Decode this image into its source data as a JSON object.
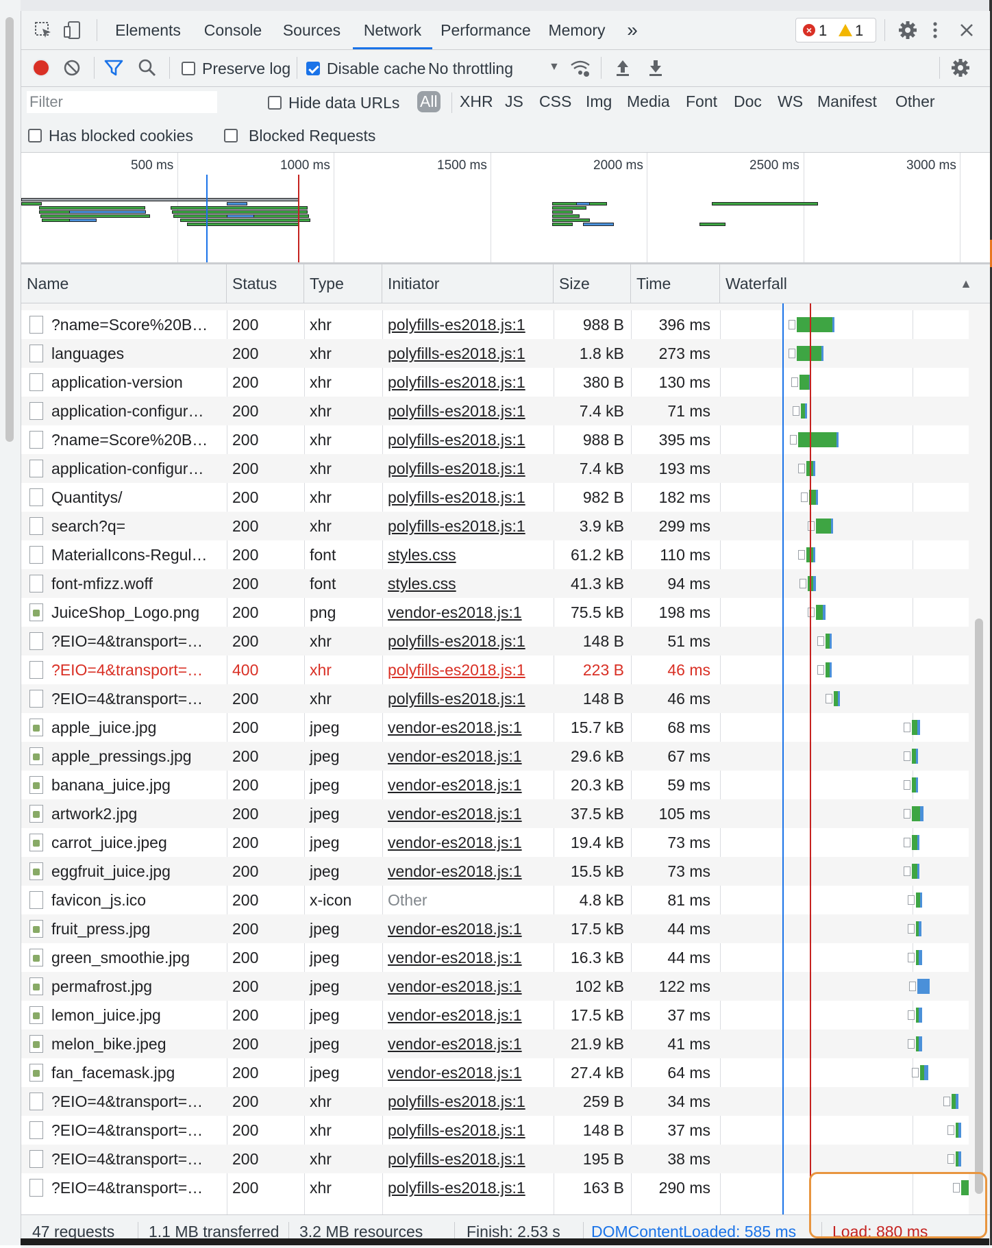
{
  "tabs": {
    "elements": "Elements",
    "console": "Console",
    "sources": "Sources",
    "network": "Network",
    "performance": "Performance",
    "memory": "Memory",
    "more": "»",
    "errors": "1",
    "warnings": "1"
  },
  "toolbar": {
    "preserve_log": "Preserve log",
    "disable_cache": "Disable cache",
    "throttling": "No throttling"
  },
  "filter": {
    "placeholder": "Filter",
    "hide_data_urls": "Hide data URLs",
    "types": [
      "All",
      "XHR",
      "JS",
      "CSS",
      "Img",
      "Media",
      "Font",
      "Doc",
      "WS",
      "Manifest",
      "Other"
    ],
    "has_blocked_cookies": "Has blocked cookies",
    "blocked_requests": "Blocked Requests"
  },
  "overview": {
    "ticks": [
      "500 ms",
      "1000 ms",
      "1500 ms",
      "2000 ms",
      "2500 ms",
      "3000 ms"
    ]
  },
  "columns": {
    "name": "Name",
    "status": "Status",
    "type": "Type",
    "initiator": "Initiator",
    "size": "Size",
    "time": "Time",
    "waterfall": "Waterfall",
    "sort_icon": "▲"
  },
  "requests": [
    {
      "name": "?name=Score%20B…",
      "status": "200",
      "type": "xhr",
      "initiator": "polyfills-es2018.js:1",
      "size": "988 B",
      "time": "396 ms",
      "icon": "file"
    },
    {
      "name": "languages",
      "status": "200",
      "type": "xhr",
      "initiator": "polyfills-es2018.js:1",
      "size": "1.8 kB",
      "time": "273 ms",
      "icon": "file"
    },
    {
      "name": "application-version",
      "status": "200",
      "type": "xhr",
      "initiator": "polyfills-es2018.js:1",
      "size": "380 B",
      "time": "130 ms",
      "icon": "file"
    },
    {
      "name": "application-configur…",
      "status": "200",
      "type": "xhr",
      "initiator": "polyfills-es2018.js:1",
      "size": "7.4 kB",
      "time": "71 ms",
      "icon": "file"
    },
    {
      "name": "?name=Score%20B…",
      "status": "200",
      "type": "xhr",
      "initiator": "polyfills-es2018.js:1",
      "size": "988 B",
      "time": "395 ms",
      "icon": "file"
    },
    {
      "name": "application-configur…",
      "status": "200",
      "type": "xhr",
      "initiator": "polyfills-es2018.js:1",
      "size": "7.4 kB",
      "time": "193 ms",
      "icon": "file"
    },
    {
      "name": "Quantitys/",
      "status": "200",
      "type": "xhr",
      "initiator": "polyfills-es2018.js:1",
      "size": "982 B",
      "time": "182 ms",
      "icon": "file"
    },
    {
      "name": "search?q=",
      "status": "200",
      "type": "xhr",
      "initiator": "polyfills-es2018.js:1",
      "size": "3.9 kB",
      "time": "299 ms",
      "icon": "file"
    },
    {
      "name": "MaterialIcons-Regul…",
      "status": "200",
      "type": "font",
      "initiator": "styles.css",
      "size": "61.2 kB",
      "time": "110 ms",
      "icon": "file"
    },
    {
      "name": "font-mfizz.woff",
      "status": "200",
      "type": "font",
      "initiator": "styles.css",
      "size": "41.3 kB",
      "time": "94 ms",
      "icon": "file"
    },
    {
      "name": "JuiceShop_Logo.png",
      "status": "200",
      "type": "png",
      "initiator": "vendor-es2018.js:1",
      "size": "75.5 kB",
      "time": "198 ms",
      "icon": "image"
    },
    {
      "name": "?EIO=4&transport=…",
      "status": "200",
      "type": "xhr",
      "initiator": "polyfills-es2018.js:1",
      "size": "148 B",
      "time": "51 ms",
      "icon": "file"
    },
    {
      "name": "?EIO=4&transport=…",
      "status": "400",
      "type": "xhr",
      "initiator": "polyfills-es2018.js:1",
      "size": "223 B",
      "time": "46 ms",
      "icon": "file",
      "error": true
    },
    {
      "name": "?EIO=4&transport=…",
      "status": "200",
      "type": "xhr",
      "initiator": "polyfills-es2018.js:1",
      "size": "148 B",
      "time": "46 ms",
      "icon": "file"
    },
    {
      "name": "apple_juice.jpg",
      "status": "200",
      "type": "jpeg",
      "initiator": "vendor-es2018.js:1",
      "size": "15.7 kB",
      "time": "68 ms",
      "icon": "image"
    },
    {
      "name": "apple_pressings.jpg",
      "status": "200",
      "type": "jpeg",
      "initiator": "vendor-es2018.js:1",
      "size": "29.6 kB",
      "time": "67 ms",
      "icon": "image"
    },
    {
      "name": "banana_juice.jpg",
      "status": "200",
      "type": "jpeg",
      "initiator": "vendor-es2018.js:1",
      "size": "20.3 kB",
      "time": "59 ms",
      "icon": "image"
    },
    {
      "name": "artwork2.jpg",
      "status": "200",
      "type": "jpeg",
      "initiator": "vendor-es2018.js:1",
      "size": "37.5 kB",
      "time": "105 ms",
      "icon": "image"
    },
    {
      "name": "carrot_juice.jpeg",
      "status": "200",
      "type": "jpeg",
      "initiator": "vendor-es2018.js:1",
      "size": "19.4 kB",
      "time": "73 ms",
      "icon": "image"
    },
    {
      "name": "eggfruit_juice.jpg",
      "status": "200",
      "type": "jpeg",
      "initiator": "vendor-es2018.js:1",
      "size": "15.5 kB",
      "time": "73 ms",
      "icon": "image"
    },
    {
      "name": "favicon_js.ico",
      "status": "200",
      "type": "x-icon",
      "initiator": "Other",
      "size": "4.8 kB",
      "time": "81 ms",
      "icon": "file",
      "initiator_plain": true
    },
    {
      "name": "fruit_press.jpg",
      "status": "200",
      "type": "jpeg",
      "initiator": "vendor-es2018.js:1",
      "size": "17.5 kB",
      "time": "44 ms",
      "icon": "image"
    },
    {
      "name": "green_smoothie.jpg",
      "status": "200",
      "type": "jpeg",
      "initiator": "vendor-es2018.js:1",
      "size": "16.3 kB",
      "time": "44 ms",
      "icon": "image"
    },
    {
      "name": "permafrost.jpg",
      "status": "200",
      "type": "jpeg",
      "initiator": "vendor-es2018.js:1",
      "size": "102 kB",
      "time": "122 ms",
      "icon": "image"
    },
    {
      "name": "lemon_juice.jpg",
      "status": "200",
      "type": "jpeg",
      "initiator": "vendor-es2018.js:1",
      "size": "17.5 kB",
      "time": "37 ms",
      "icon": "image"
    },
    {
      "name": "melon_bike.jpeg",
      "status": "200",
      "type": "jpeg",
      "initiator": "vendor-es2018.js:1",
      "size": "21.9 kB",
      "time": "41 ms",
      "icon": "image"
    },
    {
      "name": "fan_facemask.jpg",
      "status": "200",
      "type": "jpeg",
      "initiator": "vendor-es2018.js:1",
      "size": "27.4 kB",
      "time": "64 ms",
      "icon": "image"
    },
    {
      "name": "?EIO=4&transport=…",
      "status": "200",
      "type": "xhr",
      "initiator": "polyfills-es2018.js:1",
      "size": "259 B",
      "time": "34 ms",
      "icon": "file"
    },
    {
      "name": "?EIO=4&transport=…",
      "status": "200",
      "type": "xhr",
      "initiator": "polyfills-es2018.js:1",
      "size": "148 B",
      "time": "37 ms",
      "icon": "file"
    },
    {
      "name": "?EIO=4&transport=…",
      "status": "200",
      "type": "xhr",
      "initiator": "polyfills-es2018.js:1",
      "size": "195 B",
      "time": "38 ms",
      "icon": "file"
    },
    {
      "name": "?EIO=4&transport=…",
      "status": "200",
      "type": "xhr",
      "initiator": "polyfills-es2018.js:1",
      "size": "163 B",
      "time": "290 ms",
      "icon": "file"
    }
  ],
  "status_bar": {
    "requests": "47 requests",
    "transferred": "1.1 MB transferred",
    "resources": "3.2 MB resources",
    "finish": "Finish: 2.53 s",
    "dom_content_loaded": "DOMContentLoaded: 585 ms",
    "load": "Load: 880 ms"
  },
  "colors": {
    "accent": "#1a73e8",
    "error": "#d93025",
    "waterfall_green": "#3ea543",
    "waterfall_blue": "#4a90d9",
    "dcl_line": "#1a73e8",
    "load_line": "#c5221f",
    "highlight": "#e8953f"
  }
}
